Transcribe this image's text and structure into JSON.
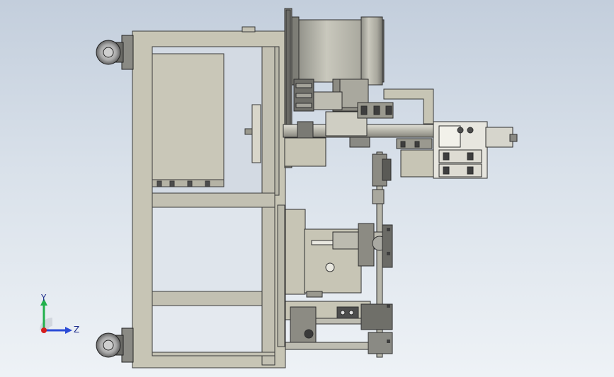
{
  "viewport": {
    "background_top": "#c3cedc",
    "background_bottom": "#eef2f6"
  },
  "model": {
    "frame_color": "#c7c5b5",
    "steel_color": "#c2c0b2",
    "edge_color": "#3a3a3a",
    "dark_part_color": "#4d4d4d"
  },
  "triad": {
    "y_label": "Y",
    "z_label": "Z",
    "y_color": "#22b14c",
    "z_color": "#2b4bd6",
    "x_color": "#d61e1e"
  }
}
